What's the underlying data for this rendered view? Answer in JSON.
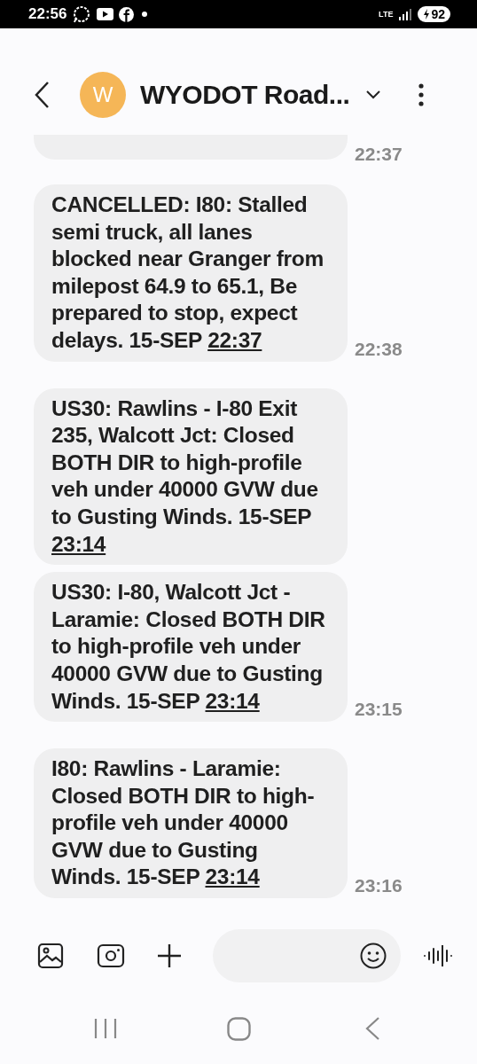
{
  "status_bar": {
    "time": "22:56",
    "network": "LTE",
    "battery": "92"
  },
  "header": {
    "avatar_letter": "W",
    "title": "WYODOT Road..."
  },
  "messages": [
    {
      "kind": "partial",
      "time": "22:37"
    },
    {
      "kind": "full",
      "text": "CANCELLED: I80: Stalled semi truck, all lanes blocked near Granger from milepost 64.9 to 65.1, Be prepared to stop, expect delays. 15-SEP ",
      "link": "22:37",
      "time": "22:38"
    },
    {
      "kind": "full",
      "text": "US30: Rawlins - I-80 Exit 235, Walcott Jct: Closed BOTH DIR to high-profile veh under 40000 GVW due to Gusting Winds.  15-SEP ",
      "link": "23:14",
      "grouped": true
    },
    {
      "kind": "full",
      "text": "US30: I-80, Walcott Jct - Laramie: Closed BOTH DIR to high-profile veh under 40000 GVW due to Gusting Winds.  15-SEP ",
      "link": "23:14",
      "time": "23:15"
    },
    {
      "kind": "full",
      "text": "I80: Rawlins - Laramie: Closed BOTH DIR to high-profile veh under 40000 GVW due to Gusting Winds.  15-SEP ",
      "link": "23:14",
      "time": "23:16"
    }
  ]
}
